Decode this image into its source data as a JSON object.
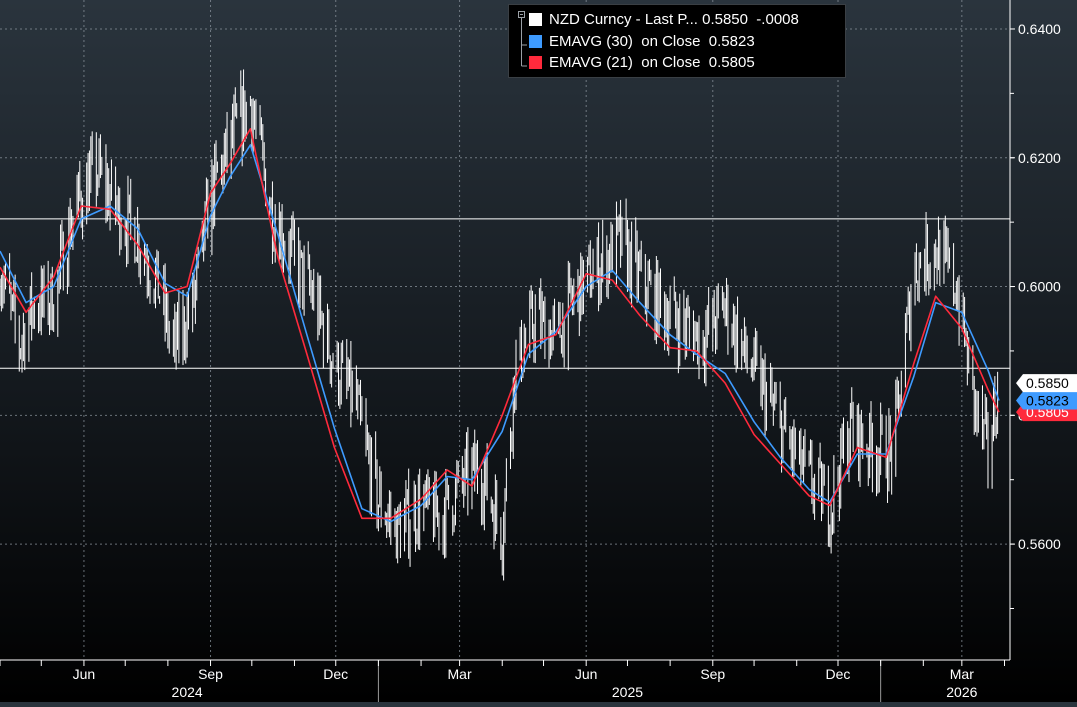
{
  "legend": {
    "rows": [
      {
        "label": "NZD Curncy - Last P... 0.5850  -.0008",
        "color": "#ffffff",
        "icon": "white-square"
      },
      {
        "label": "EMAVG (30)  on Close  0.5823",
        "color": "#3e9bff",
        "icon": "blue-square"
      },
      {
        "label": "EMAVG (21)  on Close  0.5805",
        "color": "#ff2a3c",
        "icon": "red-square"
      }
    ]
  },
  "colors": {
    "price": "#ffffff",
    "ema30": "#3e9bff",
    "ema21": "#ff2a3c",
    "grid": "#8a939c",
    "axis_text": "#ffffff",
    "last_price_tag": "#ffffff",
    "ema30_tag": "#3e9bff",
    "ema21_tag": "#ff2a3c"
  },
  "chart_data": {
    "type": "line",
    "title": "",
    "xlabel": "",
    "ylabel": "",
    "ylim": [
      0.542,
      0.6445
    ],
    "grid": true,
    "legend_position": "top-center",
    "y_ticks": [
      "0.6400",
      "0.6200",
      "0.6000",
      "0.5800",
      "0.5600"
    ],
    "x_ticks": [
      "Jun",
      "Sep",
      "Dec",
      "Mar",
      "Jun",
      "Sep",
      "Dec",
      "Mar"
    ],
    "year_labels": [
      "2024",
      "2025",
      "2026"
    ],
    "horizontal_lines": [
      0.6105,
      0.5873
    ],
    "last_value_tags": [
      {
        "name": "NZD Curncy",
        "value": "0.5850"
      },
      {
        "name": "EMAVG (30)",
        "value": "0.5823"
      },
      {
        "name": "EMAVG (21)",
        "value": "0.5805"
      }
    ],
    "series": [
      {
        "name": "NZD Curncy - Last Price",
        "dates": [
          "2024-04-01",
          "2024-04-15",
          "2024-04-25",
          "2024-05-10",
          "2024-05-25",
          "2024-06-10",
          "2024-06-25",
          "2024-07-10",
          "2024-07-25",
          "2024-08-05",
          "2024-08-20",
          "2024-09-01",
          "2024-09-15",
          "2024-09-30",
          "2024-10-15",
          "2024-10-30",
          "2024-11-15",
          "2024-11-30",
          "2024-12-15",
          "2024-12-31",
          "2025-01-15",
          "2025-01-31",
          "2025-02-15",
          "2025-03-01",
          "2025-03-15",
          "2025-04-01",
          "2025-04-10",
          "2025-04-25",
          "2025-05-10",
          "2025-05-25",
          "2025-06-10",
          "2025-06-25",
          "2025-07-10",
          "2025-07-25",
          "2025-08-10",
          "2025-08-25",
          "2025-09-10",
          "2025-09-25",
          "2025-10-10",
          "2025-10-25",
          "2025-11-10",
          "2025-11-25",
          "2025-12-10",
          "2025-12-25",
          "2026-01-10",
          "2026-01-25",
          "2026-02-10",
          "2026-02-25",
          "2026-03-10",
          "2026-03-20",
          "2026-03-28"
        ],
        "values": [
          0.603,
          0.591,
          0.597,
          0.598,
          0.612,
          0.618,
          0.612,
          0.608,
          0.6,
          0.59,
          0.598,
          0.614,
          0.622,
          0.629,
          0.612,
          0.605,
          0.598,
          0.588,
          0.582,
          0.567,
          0.562,
          0.566,
          0.564,
          0.569,
          0.572,
          0.562,
          0.587,
          0.595,
          0.592,
          0.599,
          0.603,
          0.607,
          0.601,
          0.597,
          0.594,
          0.592,
          0.597,
          0.589,
          0.583,
          0.576,
          0.57,
          0.566,
          0.578,
          0.575,
          0.574,
          0.603,
          0.606,
          0.6,
          0.582,
          0.574,
          0.585
        ]
      },
      {
        "name": "EMAVG (30) on Close",
        "dates": [
          "2024-04-01",
          "2024-04-20",
          "2024-05-10",
          "2024-05-30",
          "2024-06-20",
          "2024-07-10",
          "2024-07-30",
          "2024-08-15",
          "2024-09-01",
          "2024-09-15",
          "2024-09-30",
          "2024-10-20",
          "2024-11-10",
          "2024-11-30",
          "2024-12-20",
          "2025-01-10",
          "2025-02-01",
          "2025-02-20",
          "2025-03-10",
          "2025-04-01",
          "2025-04-20",
          "2025-05-10",
          "2025-06-01",
          "2025-06-20",
          "2025-07-10",
          "2025-08-01",
          "2025-08-20",
          "2025-09-10",
          "2025-10-01",
          "2025-10-20",
          "2025-11-10",
          "2025-11-25",
          "2025-12-15",
          "2026-01-05",
          "2026-01-25",
          "2026-02-10",
          "2026-03-01",
          "2026-03-20",
          "2026-03-28"
        ],
        "values": [
          0.6055,
          0.5975,
          0.6,
          0.6105,
          0.6125,
          0.609,
          0.6005,
          0.5985,
          0.611,
          0.617,
          0.622,
          0.608,
          0.5925,
          0.578,
          0.5655,
          0.5635,
          0.566,
          0.5705,
          0.57,
          0.5775,
          0.5895,
          0.593,
          0.6,
          0.6025,
          0.5975,
          0.5925,
          0.5895,
          0.5865,
          0.579,
          0.5735,
          0.5685,
          0.5665,
          0.574,
          0.574,
          0.586,
          0.5975,
          0.596,
          0.587,
          0.5823
        ]
      },
      {
        "name": "EMAVG (21) on Close",
        "dates": [
          "2024-04-01",
          "2024-04-20",
          "2024-05-10",
          "2024-05-30",
          "2024-06-20",
          "2024-07-10",
          "2024-07-30",
          "2024-08-15",
          "2024-09-01",
          "2024-09-15",
          "2024-09-30",
          "2024-10-20",
          "2024-11-10",
          "2024-11-30",
          "2024-12-20",
          "2025-01-10",
          "2025-02-01",
          "2025-02-20",
          "2025-03-10",
          "2025-04-01",
          "2025-04-20",
          "2025-05-10",
          "2025-06-01",
          "2025-06-20",
          "2025-07-10",
          "2025-08-01",
          "2025-08-20",
          "2025-09-10",
          "2025-10-01",
          "2025-10-20",
          "2025-11-10",
          "2025-11-25",
          "2025-12-15",
          "2026-01-05",
          "2026-01-25",
          "2026-02-10",
          "2026-03-01",
          "2026-03-20",
          "2026-03-28"
        ],
        "values": [
          0.603,
          0.596,
          0.6015,
          0.6125,
          0.612,
          0.6065,
          0.599,
          0.6,
          0.6145,
          0.619,
          0.6245,
          0.6045,
          0.5895,
          0.575,
          0.564,
          0.564,
          0.567,
          0.5715,
          0.569,
          0.58,
          0.591,
          0.5925,
          0.602,
          0.601,
          0.5955,
          0.5905,
          0.59,
          0.585,
          0.577,
          0.5725,
          0.5675,
          0.566,
          0.575,
          0.5735,
          0.588,
          0.5985,
          0.5935,
          0.584,
          0.5805
        ]
      }
    ]
  }
}
